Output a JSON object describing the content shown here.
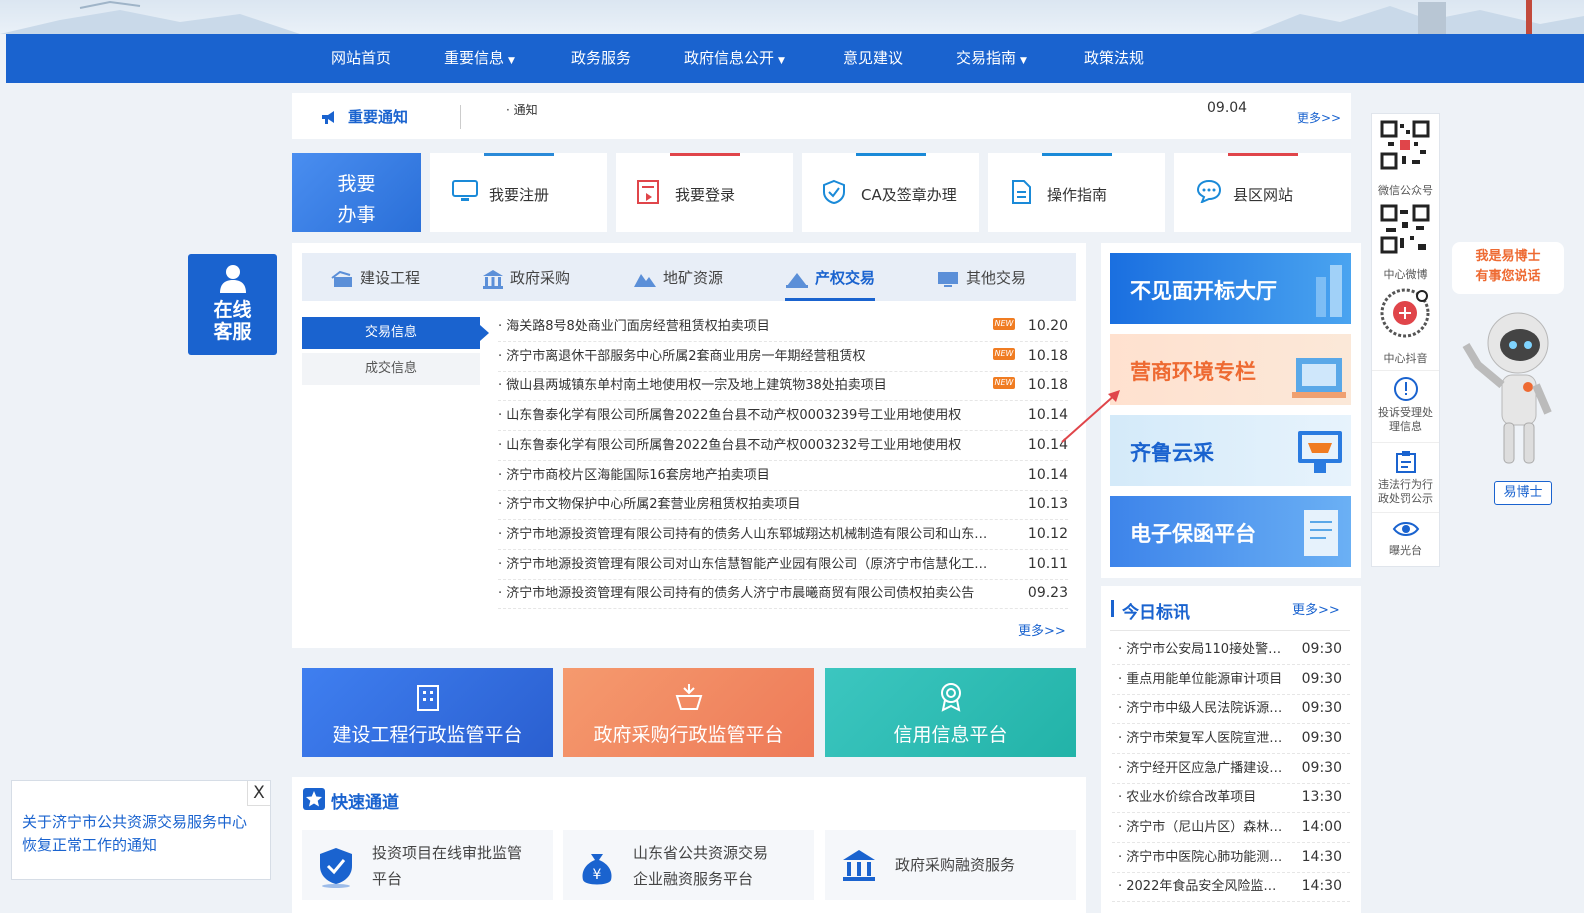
{
  "nav": {
    "items": [
      {
        "label": "网站首页",
        "dropdown": false
      },
      {
        "label": "重要信息",
        "dropdown": true
      },
      {
        "label": "政务服务",
        "dropdown": false
      },
      {
        "label": "政府信息公开",
        "dropdown": true
      },
      {
        "label": "意见建议",
        "dropdown": false
      },
      {
        "label": "交易指南",
        "dropdown": true
      },
      {
        "label": "政策法规",
        "dropdown": false
      }
    ],
    "caret": "▼"
  },
  "notice": {
    "title": "重要通知",
    "item": "通知",
    "date": "09.04",
    "more": "更多>>"
  },
  "services": {
    "main_label_1": "我要",
    "main_label_2": "办事",
    "tiles": [
      {
        "label": "我要注册",
        "icon": "monitor-icon"
      },
      {
        "label": "我要登录",
        "icon": "login-form-icon"
      },
      {
        "label": "CA及签章办理",
        "icon": "shield-check-icon"
      },
      {
        "label": "操作指南",
        "icon": "document-icon"
      },
      {
        "label": "县区网站",
        "icon": "chat-icon"
      }
    ]
  },
  "online_service": {
    "line1": "在线",
    "line2": "客服"
  },
  "trade": {
    "tabs": [
      {
        "label": "建设工程",
        "icon": "construction-icon"
      },
      {
        "label": "政府采购",
        "icon": "government-building-icon"
      },
      {
        "label": "地矿资源",
        "icon": "mountain-icon"
      },
      {
        "label": "产权交易",
        "icon": "property-icon",
        "active": true
      },
      {
        "label": "其他交易",
        "icon": "computer-icon"
      }
    ],
    "subtabs": [
      {
        "label": "交易信息",
        "active": true
      },
      {
        "label": "成交信息",
        "active": false
      }
    ],
    "new_badge": "NEW",
    "rows": [
      {
        "title": "海关路8号8处商业门面房经营租赁权拍卖项目",
        "date": "10.20",
        "new": true
      },
      {
        "title": "济宁市离退休干部服务中心所属2套商业用房一年期经营租赁权",
        "date": "10.18",
        "new": true
      },
      {
        "title": "微山县两城镇东单村南土地使用权一宗及地上建筑物38处拍卖项目",
        "date": "10.18",
        "new": true
      },
      {
        "title": "山东鲁泰化学有限公司所属鲁2022鱼台县不动产权0003239号工业用地使用权",
        "date": "10.14",
        "new": false
      },
      {
        "title": "山东鲁泰化学有限公司所属鲁2022鱼台县不动产权0003232号工业用地使用权",
        "date": "10.14",
        "new": false
      },
      {
        "title": "济宁市商校片区海能国际16套房地产拍卖项目",
        "date": "10.14",
        "new": false
      },
      {
        "title": "济宁市文物保护中心所属2套营业房租赁权拍卖项目",
        "date": "10.13",
        "new": false
      },
      {
        "title": "济宁市地源投资管理有限公司持有的债务人山东郓城翔达机械制造有限公司和山东…",
        "date": "10.12",
        "new": false
      },
      {
        "title": "济宁市地源投资管理有限公司对山东信慧智能产业园有限公司（原济宁市信慧化工…",
        "date": "10.11",
        "new": false
      },
      {
        "title": "济宁市地源投资管理有限公司持有的债务人济宁市晨曦商贸有限公司债权拍卖公告",
        "date": "09.23",
        "new": false
      }
    ],
    "more": "更多>>"
  },
  "platforms": [
    {
      "label": "建设工程行政监管平台",
      "icon": "building-icon"
    },
    {
      "label": "政府采购行政监管平台",
      "icon": "basket-icon"
    },
    {
      "label": "信用信息平台",
      "icon": "award-icon"
    }
  ],
  "quick": {
    "title": "快速通道",
    "items": [
      {
        "line1": "投资项目在线审批监管",
        "line2": "平台",
        "icon": "shield-icon"
      },
      {
        "line1": "山东省公共资源交易",
        "line2": "企业融资服务平台",
        "icon": "money-bag-icon"
      },
      {
        "line1": "政府采购融资服务",
        "line2": "",
        "icon": "bank-icon"
      }
    ]
  },
  "promos": [
    {
      "label": "不见面开标大厅"
    },
    {
      "label": "营商环境专栏"
    },
    {
      "label": "齐鲁云采"
    },
    {
      "label": "电子保函平台"
    }
  ],
  "today": {
    "title": "今日标讯",
    "more": "更多>>",
    "rows": [
      {
        "title": "济宁市公安局110接处警…",
        "time": "09:30"
      },
      {
        "title": "重点用能单位能源审计项目",
        "time": "09:30"
      },
      {
        "title": "济宁市中级人民法院诉源…",
        "time": "09:30"
      },
      {
        "title": "济宁市荣复军人医院宣泄…",
        "time": "09:30"
      },
      {
        "title": "济宁经开区应急广播建设…",
        "time": "09:30"
      },
      {
        "title": "农业水价综合改革项目",
        "time": "13:30"
      },
      {
        "title": "济宁市（尼山片区）森林…",
        "time": "14:00"
      },
      {
        "title": "济宁市中医院心肺功能测…",
        "time": "14:30"
      },
      {
        "title": "2022年食品安全风险监…",
        "time": "14:30"
      }
    ]
  },
  "rail": [
    {
      "label": "微信公众号",
      "icon": "qr-code-icon"
    },
    {
      "label": "中心微博",
      "icon": "qr-code-icon"
    },
    {
      "label": "中心抖音",
      "icon": "qr-code-icon"
    },
    {
      "label": "投诉受理处理信息",
      "icon": "exclamation-circle-icon"
    },
    {
      "label": "违法行为行政处罚公示",
      "icon": "clipboard-icon"
    },
    {
      "label": "曝光台",
      "icon": "eye-icon"
    }
  ],
  "assistant": {
    "bubble_1": "我是易博士",
    "bubble_2": "有事您说话",
    "name": "易博士"
  },
  "popup": {
    "close": "X",
    "text": "关于济宁市公共资源交易服务中心恢复正常工作的通知"
  },
  "colors": {
    "primary": "#1a63cf",
    "accent_red": "#e0454a",
    "orange": "#f07c22",
    "teal": "#2ec2b6"
  }
}
